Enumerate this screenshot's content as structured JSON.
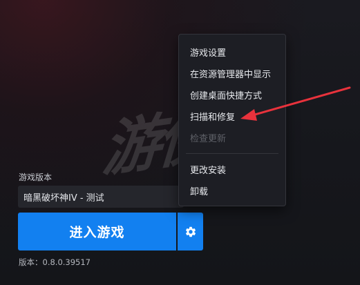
{
  "watermark": {
    "text": "游侠网"
  },
  "version_section": {
    "label": "游戏版本",
    "selected": "暗黑破坏神IV - 测试"
  },
  "play_button": {
    "label": "进入游戏"
  },
  "settings_button": {
    "icon": "gear-icon"
  },
  "version_info": "版本：0.8.0.39517",
  "context_menu": {
    "items": [
      {
        "label": "游戏设置",
        "enabled": true
      },
      {
        "label": "在资源管理器中显示",
        "enabled": true
      },
      {
        "label": "创建桌面快捷方式",
        "enabled": true
      },
      {
        "label": "扫描和修复",
        "enabled": true
      },
      {
        "label": "检查更新",
        "enabled": false
      },
      {
        "label": "更改安装",
        "enabled": true
      },
      {
        "label": "卸载",
        "enabled": true
      }
    ]
  },
  "colors": {
    "primary_button": "#1280f0",
    "menu_background": "#1d1e24",
    "annotation_arrow": "#e8323c"
  }
}
